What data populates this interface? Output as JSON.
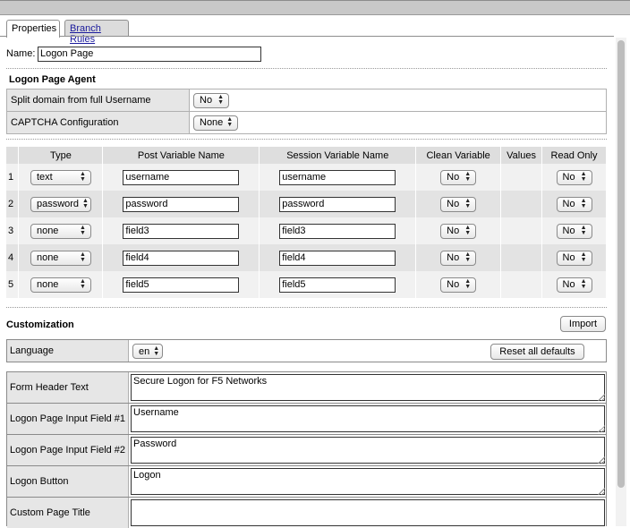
{
  "tabs": {
    "properties": "Properties",
    "branch_rules": "Branch Rules"
  },
  "name": {
    "label": "Name:",
    "value": "Logon Page"
  },
  "agent": {
    "title": "Logon Page Agent",
    "rows": [
      {
        "label": "Split domain from full Username",
        "value": "No"
      },
      {
        "label": "CAPTCHA Configuration",
        "value": "None"
      }
    ]
  },
  "variables": {
    "headers": [
      "",
      "Type",
      "Post Variable Name",
      "Session Variable Name",
      "Clean Variable",
      "Values",
      "Read Only"
    ],
    "rows": [
      {
        "num": "1",
        "type": "text",
        "post": "username",
        "session": "username",
        "clean": "No",
        "readonly": "No"
      },
      {
        "num": "2",
        "type": "password",
        "post": "password",
        "session": "password",
        "clean": "No",
        "readonly": "No"
      },
      {
        "num": "3",
        "type": "none",
        "post": "field3",
        "session": "field3",
        "clean": "No",
        "readonly": "No"
      },
      {
        "num": "4",
        "type": "none",
        "post": "field4",
        "session": "field4",
        "clean": "No",
        "readonly": "No"
      },
      {
        "num": "5",
        "type": "none",
        "post": "field5",
        "session": "field5",
        "clean": "No",
        "readonly": "No"
      }
    ]
  },
  "customization": {
    "title": "Customization",
    "import_label": "Import",
    "language_label": "Language",
    "language_value": "en",
    "reset_label": "Reset all defaults",
    "fields": [
      {
        "label": "Form Header Text",
        "value": "Secure Logon for F5 Networks"
      },
      {
        "label": "Logon Page Input Field #1",
        "value": "Username"
      },
      {
        "label": "Logon Page Input Field #2",
        "value": "Password"
      },
      {
        "label": "Logon Button",
        "value": "Logon"
      },
      {
        "label": "Custom Page Title",
        "value": ""
      }
    ]
  }
}
